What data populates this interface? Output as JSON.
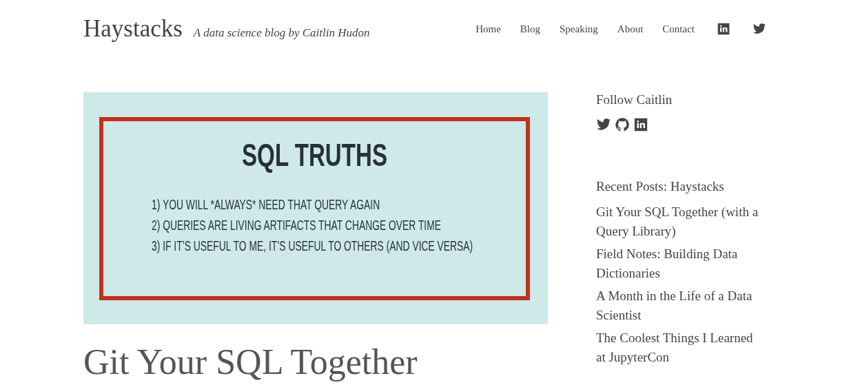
{
  "site": {
    "title": "Haystacks",
    "tagline": "A data science blog by Caitlin Hudon"
  },
  "nav": [
    "Home",
    "Blog",
    "Speaking",
    "About",
    "Contact"
  ],
  "featured_image": {
    "title": "SQL TRUTHS",
    "lines": [
      "1) YOU WILL *ALWAYS* NEED THAT QUERY AGAIN",
      "2) QUERIES ARE LIVING ARTIFACTS THAT CHANGE OVER TIME",
      "3) IF IT’S USEFUL TO ME, IT’S USEFUL TO OTHERS (AND VICE VERSA)"
    ]
  },
  "post": {
    "title": "Git Your SQL Together"
  },
  "sidebar": {
    "follow_heading": "Follow Caitlin",
    "recent_heading": "Recent Posts: Haystacks",
    "recent_posts": [
      "Git Your SQL Together (with a Query Library)",
      "Field Notes: Building Data Dictionaries",
      "A Month in the Life of a Data Scientist",
      "The Coolest Things I Learned at JupyterCon"
    ]
  }
}
